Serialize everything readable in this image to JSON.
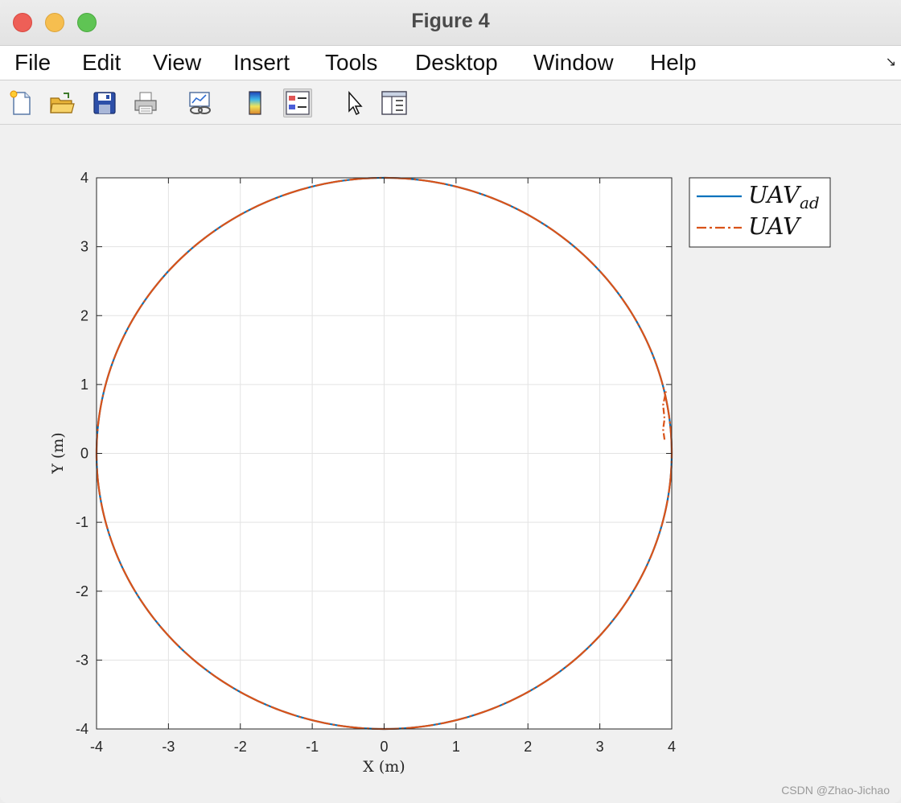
{
  "window": {
    "title": "Figure 4"
  },
  "menu": {
    "items": [
      "File",
      "Edit",
      "View",
      "Insert",
      "Tools",
      "Desktop",
      "Window",
      "Help"
    ]
  },
  "toolbar": {
    "buttons": [
      {
        "icon": "new-figure-icon"
      },
      {
        "icon": "open-file-icon"
      },
      {
        "icon": "save-icon"
      },
      {
        "icon": "print-icon"
      },
      {
        "icon": "link-plot-icon"
      },
      {
        "icon": "colorbar-icon"
      },
      {
        "icon": "legend-icon"
      },
      {
        "icon": "pointer-icon"
      },
      {
        "icon": "property-editor-icon"
      }
    ]
  },
  "colors": {
    "uav_ad": "#0072bd",
    "uav": "#d95319",
    "grid": "#e3e3e3",
    "axes": "#262626"
  },
  "chart_data": {
    "type": "line",
    "xlabel": "X (m)",
    "ylabel": "Y (m)",
    "xlim": [
      -4,
      4
    ],
    "ylim": [
      -4,
      4
    ],
    "xticks": [
      "-4",
      "-3",
      "-2",
      "-1",
      "0",
      "1",
      "2",
      "3",
      "4"
    ],
    "yticks": [
      "-4",
      "-3",
      "-2",
      "-1",
      "0",
      "1",
      "2",
      "3",
      "4"
    ],
    "grid": true,
    "legend_position": "outside-top-right",
    "series": [
      {
        "name_base": "UAV",
        "name_sub": "ad",
        "style": "solid",
        "color": "#0072bd",
        "shape": "circle",
        "center": [
          0,
          0
        ],
        "radius": 4
      },
      {
        "name_base": "UAV",
        "name_sub": "",
        "style": "dashdot",
        "color": "#d95319",
        "shape": "circle",
        "center": [
          0,
          0
        ],
        "radius": 4,
        "start_transient": [
          [
            3.9,
            0.2
          ],
          [
            3.88,
            0.35
          ],
          [
            3.9,
            0.5
          ],
          [
            3.88,
            0.7
          ],
          [
            3.92,
            0.9
          ]
        ]
      }
    ]
  },
  "watermark": "CSDN @Zhao-Jichao"
}
